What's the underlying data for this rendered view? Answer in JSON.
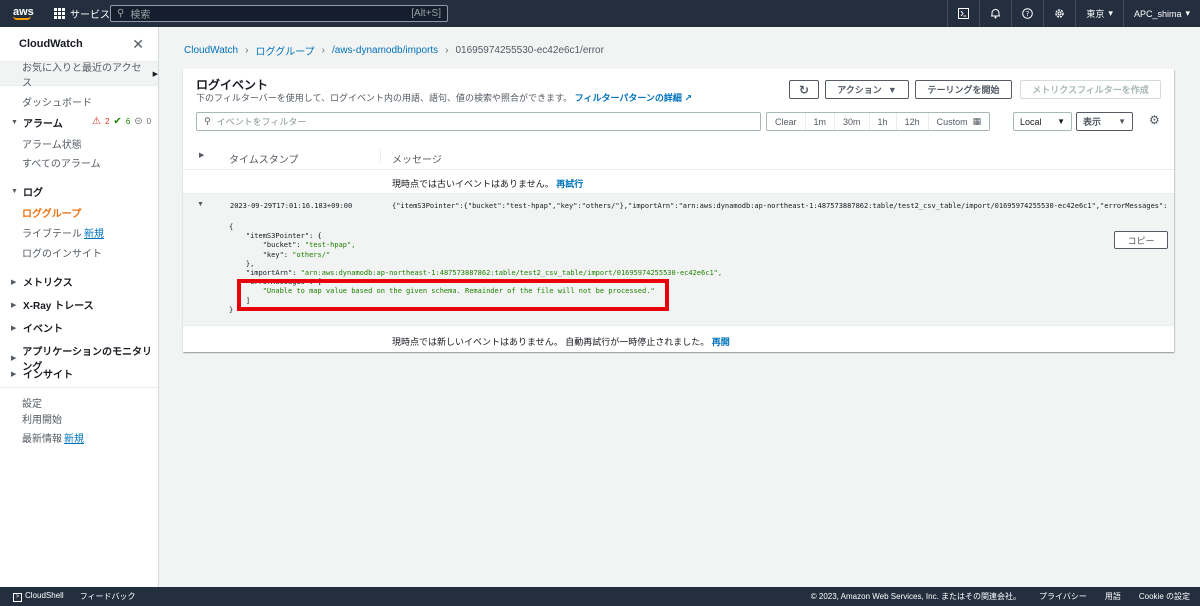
{
  "topnav": {
    "logo": "aws",
    "services": "サービス",
    "search_placeholder": "検索",
    "search_shortcut": "[Alt+S]",
    "region": "東京",
    "account": "APC_shima"
  },
  "sidebar": {
    "title": "CloudWatch",
    "favorites": "お気に入りと最近のアクセス",
    "dashboard": "ダッシュボード",
    "alarms": "アラーム",
    "alarm_counts": {
      "alarm": "2",
      "ok": "6",
      "insufficient": "0"
    },
    "alarm_state": "アラーム状態",
    "all_alarms": "すべてのアラーム",
    "logs": "ログ",
    "log_groups": "ロググループ",
    "live_tail": "ライブテール",
    "new_badge": "新規",
    "logs_insights": "ログのインサイト",
    "metrics": "メトリクス",
    "xray": "X-Ray トレース",
    "events": "イベント",
    "app_monitoring": "アプリケーションのモニタリング",
    "insights": "インサイト",
    "settings": "設定",
    "getting_started": "利用開始",
    "whats_new": "最新情報"
  },
  "breadcrumb": [
    "CloudWatch",
    "ロググループ",
    "/aws-dynamodb/imports",
    "01695974255530-ec42e6c1/error"
  ],
  "panel": {
    "title": "ログイベント",
    "description": "下のフィルターバーを使用して、ログイベント内の用語、語句、値の検索や照合ができます。",
    "description_link": "フィルターパターンの詳細",
    "actions_button": "アクション",
    "tailing_button": "テーリングを開始",
    "metric_filter_button": "メトリクスフィルターを作成",
    "filter_placeholder": "イベントをフィルター",
    "time_ranges": [
      "Clear",
      "1m",
      "30m",
      "1h",
      "12h",
      "Custom"
    ],
    "timezone": "Local",
    "display": "表示",
    "col_timestamp": "タイムスタンプ",
    "col_message": "メッセージ",
    "no_older": "現時点では古いイベントはありません。",
    "retry": "再試行",
    "no_newer": "現時点では新しいイベントはありません。 自動再試行が一時停止されました。",
    "resume": "再開",
    "copy_button": "コピー"
  },
  "event": {
    "timestamp": "2023-09-29T17:01:16.183+09:00",
    "message": "{\"itemS3Pointer\":{\"bucket\":\"test-hpap\",\"key\":\"others/\"},\"importArn\":\"arn:aws:dynamodb:ap-northeast-1:487573887862:table/test2_csv_table/import/01695974255530-ec42e6c1\",\"errorMessages\":[…",
    "json": {
      "open": "{",
      "pointer_key": "\"itemS3Pointer\": {",
      "bucket_key": "\"bucket\": ",
      "bucket_val": "\"test-hpap\",",
      "key_key": "\"key\": ",
      "key_val": "\"others/\"",
      "pointer_close": "},",
      "import_key": "\"importArn\": ",
      "import_val": "\"arn:aws:dynamodb:ap-northeast-1:487573887862:table/test2_csv_table/import/01695974255530-ec42e6c1\",",
      "errors_key": "\"errorMessages\": [",
      "error_val": "\"Unable to map value based on the given schema. Remainder of the file will not be processed.\"",
      "errors_close": "]",
      "close": "}"
    }
  },
  "footer": {
    "cloudshell": "CloudShell",
    "feedback": "フィードバック",
    "copyright": "© 2023, Amazon Web Services, Inc. またはその関連会社。",
    "privacy": "プライバシー",
    "terms": "用語",
    "cookie": "Cookie の設定"
  }
}
